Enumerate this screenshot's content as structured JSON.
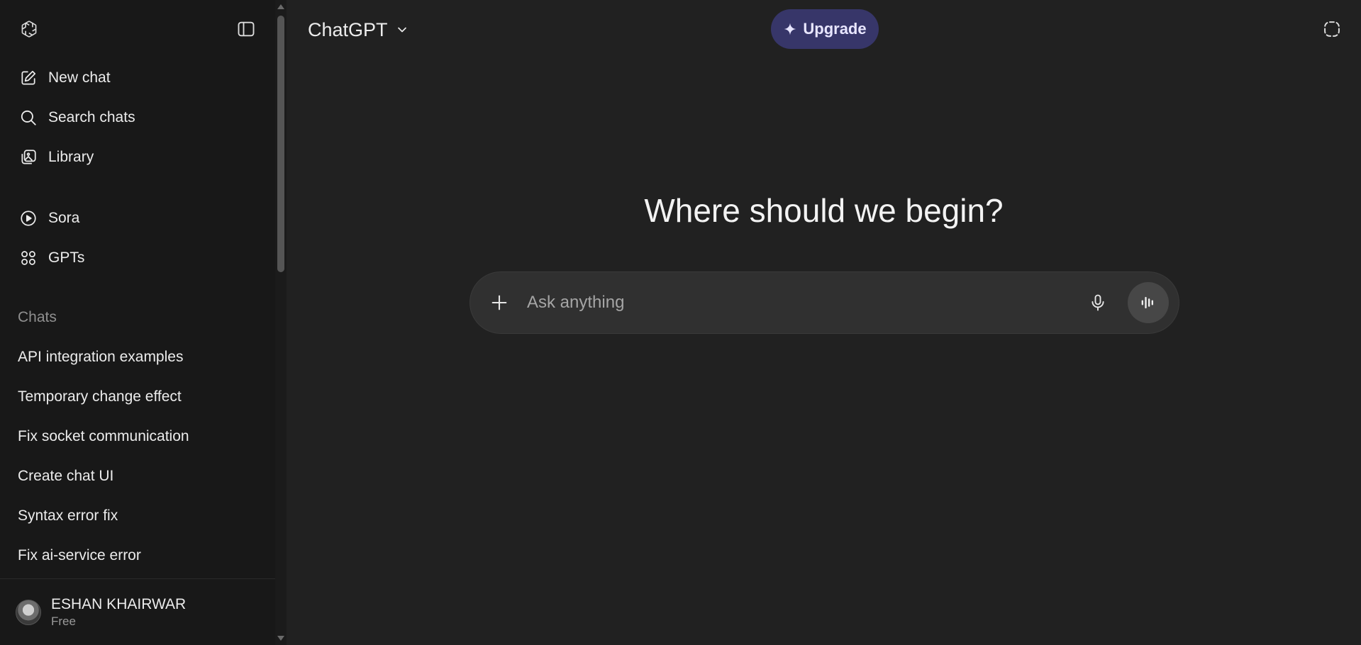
{
  "sidebar": {
    "logo_icon": "openai-logo-icon",
    "toggle_icon": "sidebar-toggle-icon",
    "primary_items": [
      {
        "label": "New chat",
        "icon": "edit-icon"
      },
      {
        "label": "Search chats",
        "icon": "search-icon"
      },
      {
        "label": "Library",
        "icon": "library-icon"
      }
    ],
    "secondary_items": [
      {
        "label": "Sora",
        "icon": "play-circle-icon"
      },
      {
        "label": "GPTs",
        "icon": "grid-icon"
      }
    ],
    "chats_label": "Chats",
    "chats": [
      "API integration examples",
      "Temporary change effect",
      "Fix socket communication",
      "Create chat UI",
      "Syntax error fix",
      "Fix ai-service error"
    ],
    "user": {
      "name": "ESHAN KHAIRWAR",
      "plan": "Free"
    }
  },
  "header": {
    "model_label": "ChatGPT",
    "upgrade_label": "Upgrade",
    "upgrade_color": "#373669",
    "temporary_chat_icon": "dashed-circle-icon"
  },
  "main": {
    "headline": "Where should we begin?",
    "composer_placeholder": "Ask anything",
    "composer_value": ""
  }
}
